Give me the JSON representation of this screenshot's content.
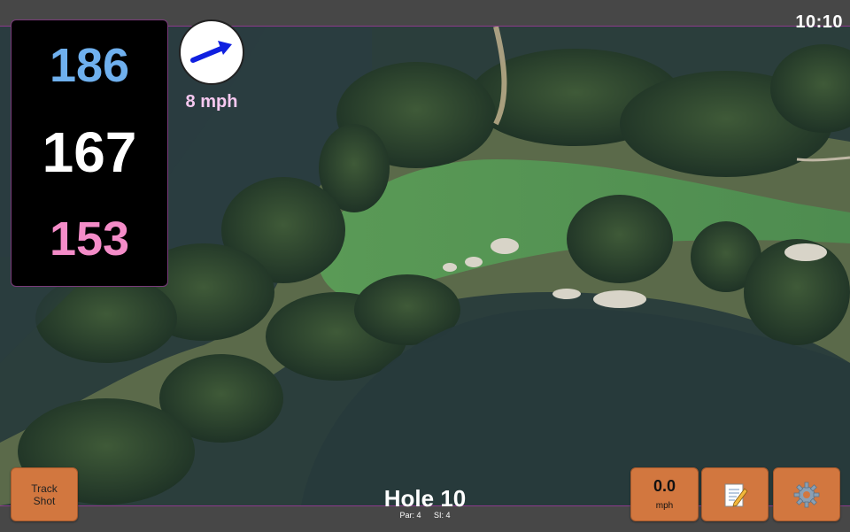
{
  "status_bar": {
    "time": "10:10"
  },
  "yardages": {
    "back": "186",
    "middle": "167",
    "front": "153"
  },
  "wind": {
    "speed": "8 mph",
    "icon": "wind-direction-arrow-icon",
    "arrow_color": "#1020e0"
  },
  "hole": {
    "title": "Hole 10",
    "par": "Par: 4",
    "stroke_index": "SI: 4"
  },
  "buttons": {
    "track_shot": {
      "line1": "Track",
      "line2": "Shot"
    },
    "speed": {
      "value": "0.0",
      "unit": "mph"
    },
    "notes": {
      "icon": "notepad-icon"
    },
    "settings": {
      "icon": "gear-icon"
    }
  },
  "colors": {
    "button": "#d2773f",
    "back_yardage": "#6fb0ee",
    "middle_yardage": "#ffffff",
    "front_yardage": "#f48cc8",
    "wind_text": "#f6c8f0"
  }
}
